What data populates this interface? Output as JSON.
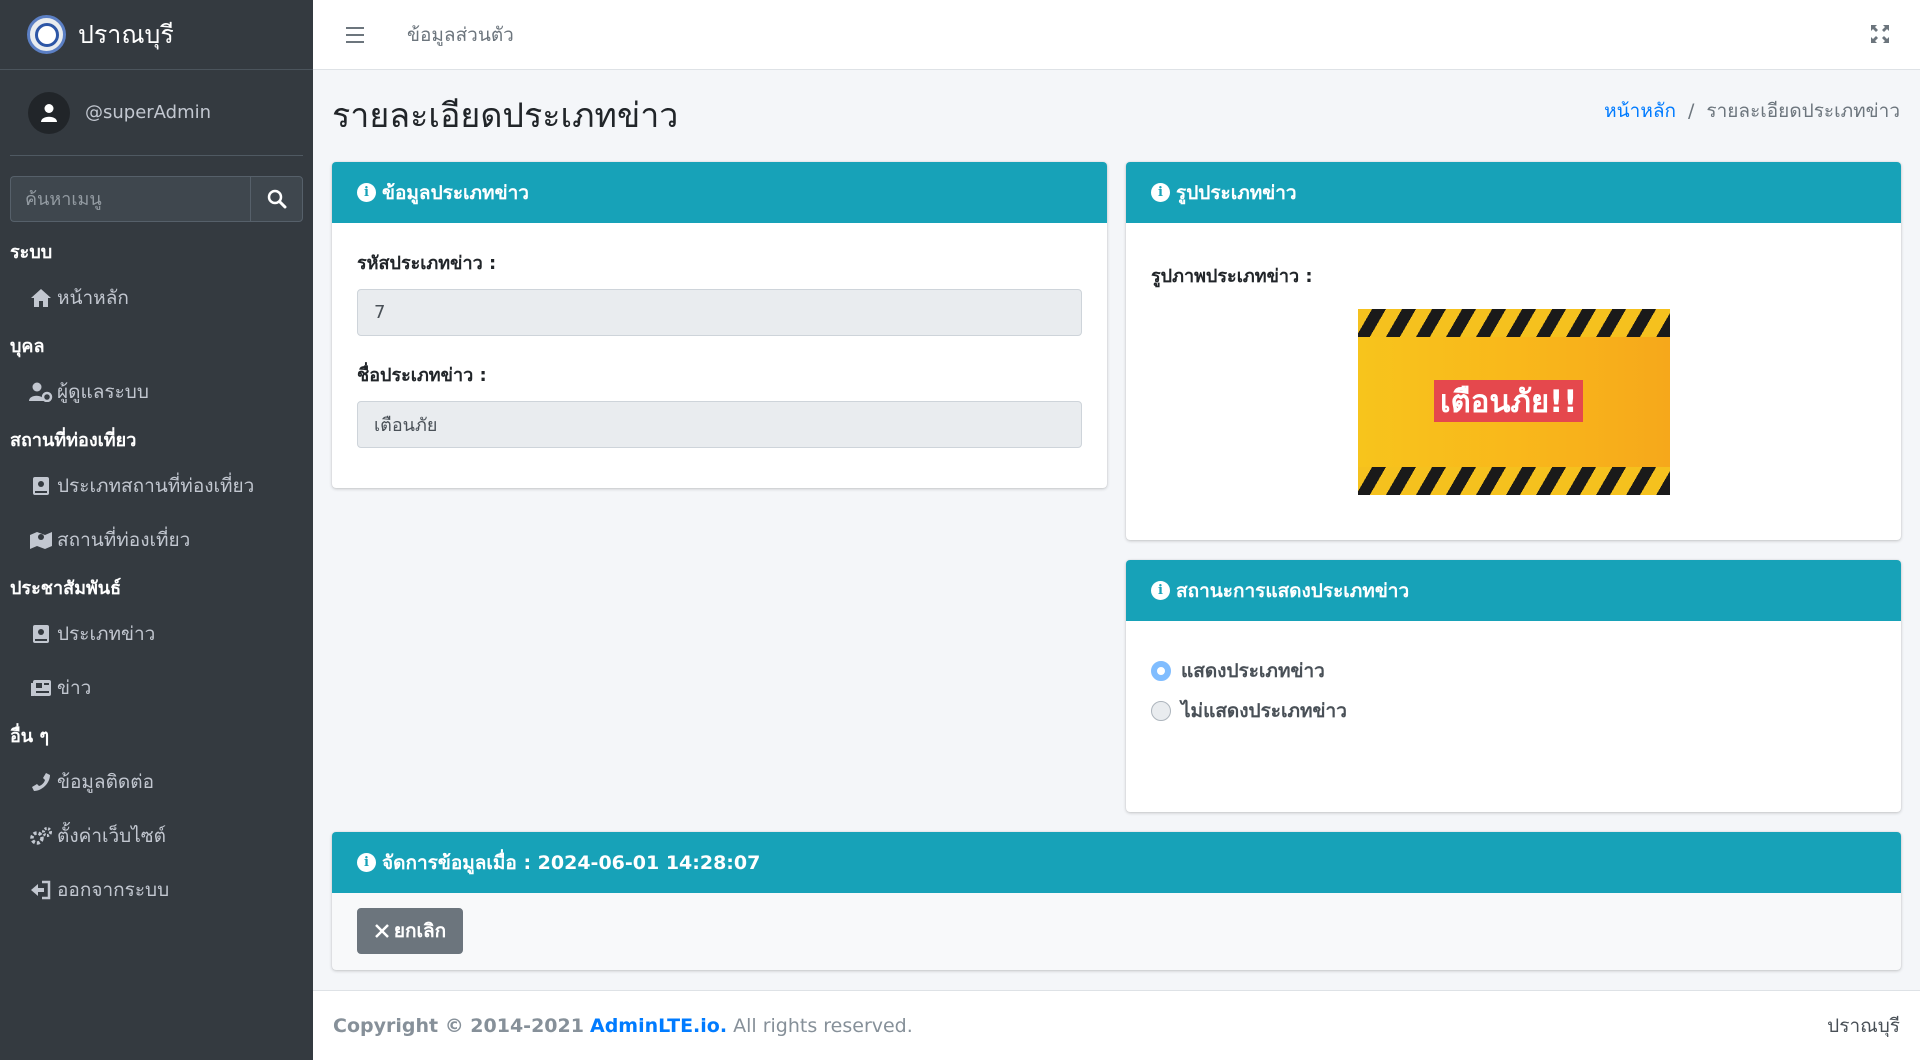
{
  "brand": {
    "name": "ปราณบุรี"
  },
  "user": {
    "name": "@superAdmin"
  },
  "search": {
    "placeholder": "ค้นหาเมนู"
  },
  "sidebar": {
    "sections": [
      {
        "header": "ระบบ",
        "items": [
          {
            "label": "หน้าหลัก",
            "icon": "home-icon"
          }
        ]
      },
      {
        "header": "บุคล",
        "items": [
          {
            "label": "ผู้ดูแลระบบ",
            "icon": "user-cog-icon"
          }
        ]
      },
      {
        "header": "สถานที่ท่องเที่ยว",
        "items": [
          {
            "label": "ประเภทสถานที่ท่องเที่ยว",
            "icon": "book-icon"
          },
          {
            "label": "สถานที่ท่องเที่ยว",
            "icon": "map-icon"
          }
        ]
      },
      {
        "header": "ประชาสัมพันธ์",
        "items": [
          {
            "label": "ประเภทข่าว",
            "icon": "book-icon"
          },
          {
            "label": "ข่าว",
            "icon": "newspaper-icon"
          }
        ]
      },
      {
        "header": "อื่น ๆ",
        "items": [
          {
            "label": "ข้อมูลติดต่อ",
            "icon": "phone-icon"
          },
          {
            "label": "ตั้งค่าเว็บไซต์",
            "icon": "cogs-icon"
          },
          {
            "label": "ออกจากระบบ",
            "icon": "sign-out-icon"
          }
        ]
      }
    ]
  },
  "navbar": {
    "link": "ข้อมูลส่วนตัว"
  },
  "page": {
    "title": "รายละเอียดประเภทข่าว"
  },
  "breadcrumb": {
    "home": "หน้าหลัก",
    "separator": "/",
    "current": "รายละเอียดประเภทข่าว"
  },
  "info_card": {
    "header": "ข้อมูลประเภทข่าว",
    "code_label": "รหัสประเภทข่าว :",
    "code_value": "7",
    "name_label": "ชื่อประเภทข่าว :",
    "name_value": "เตือนภัย"
  },
  "image_card": {
    "header": "รูปประเภทข่าว",
    "label": "รูปภาพประเภทข่าว :",
    "image_text": "เตือนภัย!!"
  },
  "status_card": {
    "header": "สถานะการแสดงประเภทข่าว",
    "options": [
      {
        "label": "แสดงประเภทข่าว",
        "checked": true
      },
      {
        "label": "ไม่แสดงประเภทข่าว",
        "checked": false
      }
    ]
  },
  "manage_card": {
    "header": "จัดการข้อมูลเมื่อ : 2024-06-01 14:28:07",
    "cancel_label": "ยกเลิก"
  },
  "footer": {
    "copyright": "Copyright © 2014-2021",
    "brand_link": "AdminLTE.io.",
    "rights": "All rights reserved.",
    "right_text": "ปราณบุรี"
  },
  "colors": {
    "sidebar": "#343a40",
    "card_header": "#17a2b8",
    "link": "#007bff",
    "button": "#6c757d"
  }
}
